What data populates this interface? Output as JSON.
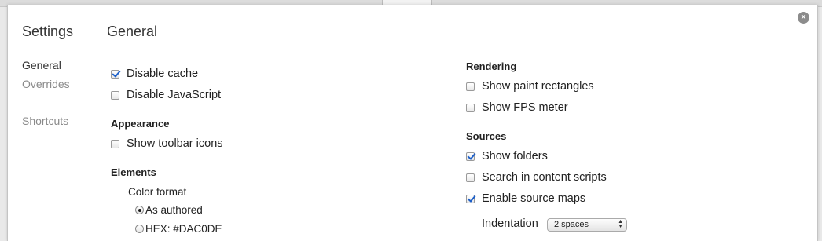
{
  "sidebar": {
    "title": "Settings",
    "items": [
      {
        "label": "General"
      },
      {
        "label": "Overrides"
      },
      {
        "label": "Shortcuts"
      }
    ]
  },
  "page": {
    "title": "General"
  },
  "general": {
    "disable_cache": {
      "label": "Disable cache",
      "checked": true
    },
    "disable_javascript": {
      "label": "Disable JavaScript",
      "checked": false
    }
  },
  "appearance": {
    "title": "Appearance",
    "show_toolbar_icons": {
      "label": "Show toolbar icons",
      "checked": false
    }
  },
  "elements": {
    "title": "Elements",
    "color_format_label": "Color format",
    "options": [
      {
        "label": "As authored",
        "selected": true
      },
      {
        "label": "HEX: #DAC0DE",
        "selected": false
      }
    ]
  },
  "rendering": {
    "title": "Rendering",
    "show_paint_rectangles": {
      "label": "Show paint rectangles",
      "checked": false
    },
    "show_fps_meter": {
      "label": "Show FPS meter",
      "checked": false
    }
  },
  "sources": {
    "title": "Sources",
    "show_folders": {
      "label": "Show folders",
      "checked": true
    },
    "search_in_content_scripts": {
      "label": "Search in content scripts",
      "checked": false
    },
    "enable_source_maps": {
      "label": "Enable source maps",
      "checked": true
    },
    "indentation_label": "Indentation",
    "indentation_value": "2 spaces"
  },
  "close_glyph": "×",
  "colors": {
    "accent": "#1c5fc9",
    "dim_text": "#8a8a8a"
  }
}
